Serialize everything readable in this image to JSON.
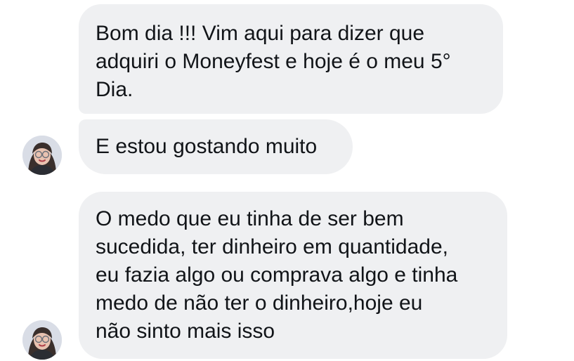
{
  "messages": [
    {
      "lines": [
        "Bom dia !!! Vim aqui para dizer que",
        "adquiri o Moneyfest e hoje é o meu 5°",
        "Dia."
      ]
    },
    {
      "lines": [
        "E estou gostando muito"
      ]
    },
    {
      "lines": [
        "O medo que eu tinha de ser bem",
        "sucedida, ter dinheiro em quantidade,",
        "eu fazia algo ou comprava algo e tinha",
        "medo de não ter o dinheiro,hoje eu",
        "não sinto mais isso"
      ]
    }
  ],
  "colors": {
    "bubble_background": "#eff0f2",
    "text": "#111418",
    "page_background": "#ffffff"
  }
}
